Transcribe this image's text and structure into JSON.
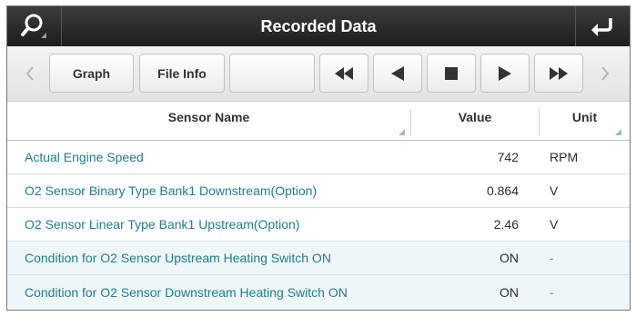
{
  "header": {
    "title": "Recorded Data",
    "search_icon": "search-icon",
    "back_icon": "return-arrow-icon"
  },
  "toolbar": {
    "graph_label": "Graph",
    "file_info_label": "File Info",
    "blank_label": "",
    "icons": [
      "chevron-left-icon",
      "rewind-icon",
      "step-back-icon",
      "stop-icon",
      "play-icon",
      "fast-forward-icon",
      "chevron-right-icon"
    ]
  },
  "table": {
    "columns": {
      "name": "Sensor Name",
      "value": "Value",
      "unit": "Unit"
    },
    "rows": [
      {
        "name": "Actual Engine Speed",
        "value": "742",
        "unit": "RPM"
      },
      {
        "name": "O2 Sensor Binary Type Bank1 Downstream(Option)",
        "value": "0.864",
        "unit": "V"
      },
      {
        "name": "O2 Sensor Linear Type Bank1 Upstream(Option)",
        "value": "2.46",
        "unit": "V"
      },
      {
        "name": "Condition for O2 Sensor Upstream Heating Switch ON",
        "value": "ON",
        "unit": "-"
      },
      {
        "name": "Condition for O2 Sensor Downstream Heating Switch ON",
        "value": "ON",
        "unit": "-"
      }
    ]
  },
  "colors": {
    "accent": "#1f7d8e",
    "titlebar": "#2b2b2b",
    "row_alt": "#eef6f7"
  }
}
